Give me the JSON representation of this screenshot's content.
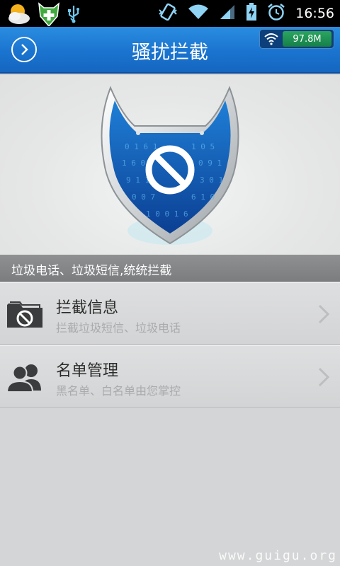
{
  "status_bar": {
    "time": "16:56",
    "icons": [
      "weather-icon",
      "plus-shield-icon",
      "usb-icon",
      "vibrate-icon",
      "wifi-icon",
      "signal-icon",
      "battery-charging-icon",
      "alarm-icon"
    ]
  },
  "header": {
    "title": "骚扰拦截",
    "traffic_value": "97.8M"
  },
  "banner": {
    "text": "垃圾电话、垃圾短信,统统拦截"
  },
  "list": [
    {
      "title": "拦截信息",
      "subtitle": "拦截垃圾短信、垃圾电话",
      "icon": "folder-block-icon"
    },
    {
      "title": "名单管理",
      "subtitle": "黑名单、白名单由您掌控",
      "icon": "contacts-icon"
    }
  ],
  "colors": {
    "header_blue": "#1a74cf",
    "banner_gray": "#858688",
    "list_bg": "#d8d9da"
  },
  "watermark": "www.guigu.org"
}
